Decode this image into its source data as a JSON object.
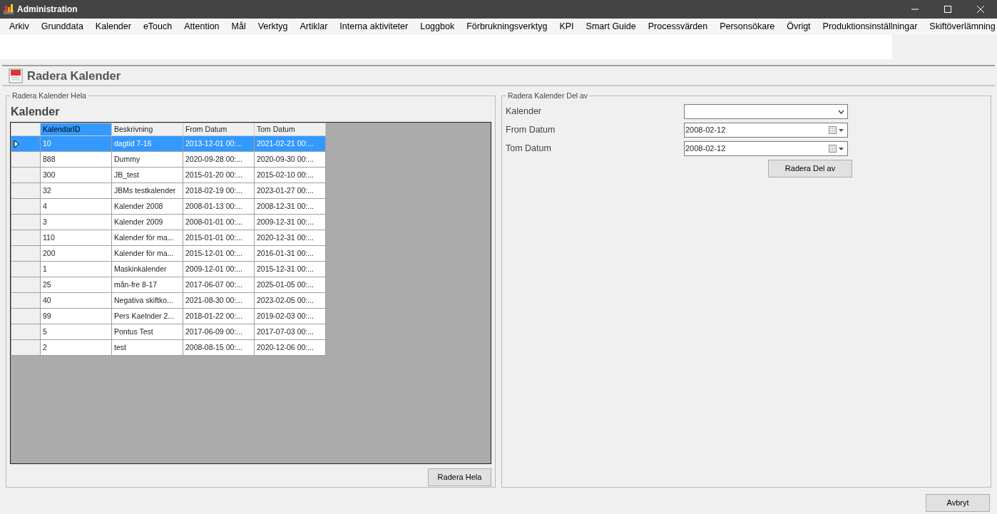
{
  "window": {
    "title": "Administration"
  },
  "menu": [
    "Arkiv",
    "Grunddata",
    "Kalender",
    "eTouch",
    "Attention",
    "Mål",
    "Verktyg",
    "Artiklar",
    "Interna aktiviteter",
    "Loggbok",
    "Förbrukningsverktyg",
    "KPI",
    "Smart Guide",
    "Processvärden",
    "Personsökare",
    "Övrigt",
    "Produktionsinställningar",
    "Skiftöverlämning"
  ],
  "page_title": "Radera Kalender",
  "left_group": {
    "legend": "Radera Kalender Hela",
    "heading": "Kalender",
    "table": {
      "columns": [
        {
          "label": "KalendarID",
          "selected": true
        },
        {
          "label": "Beskrivning",
          "selected": false
        },
        {
          "label": "From Datum",
          "selected": false
        },
        {
          "label": "Tom Datum",
          "selected": false
        }
      ],
      "rows": [
        {
          "selected": true,
          "cells": [
            "10",
            "dagtid 7-16",
            "2013-12-01 00:...",
            "2021-02-21 00:..."
          ]
        },
        {
          "selected": false,
          "cells": [
            "888",
            "Dummy",
            "2020-09-28 00:...",
            "2020-09-30 00:..."
          ]
        },
        {
          "selected": false,
          "cells": [
            "300",
            "JB_test",
            "2015-01-20 00:...",
            "2015-02-10 00:..."
          ]
        },
        {
          "selected": false,
          "cells": [
            "32",
            "JBMs testkalender",
            "2018-02-19 00:...",
            "2023-01-27 00:..."
          ]
        },
        {
          "selected": false,
          "cells": [
            "4",
            "Kalender 2008",
            "2008-01-13 00:...",
            "2008-12-31 00:..."
          ]
        },
        {
          "selected": false,
          "cells": [
            "3",
            "Kalender 2009",
            "2008-01-01 00:...",
            "2009-12-31 00:..."
          ]
        },
        {
          "selected": false,
          "cells": [
            "110",
            "Kalender för ma...",
            "2015-01-01 00:...",
            "2020-12-31 00:..."
          ]
        },
        {
          "selected": false,
          "cells": [
            "200",
            "Kalender för ma...",
            "2015-12-01 00:...",
            "2016-01-31 00:..."
          ]
        },
        {
          "selected": false,
          "cells": [
            "1",
            "Maskinkalender",
            "2009-12-01 00:...",
            "2015-12-31 00:..."
          ]
        },
        {
          "selected": false,
          "cells": [
            "25",
            "mån-fre 8-17",
            "2017-06-07 00:...",
            "2025-01-05 00:..."
          ]
        },
        {
          "selected": false,
          "cells": [
            "40",
            "Negativa skiftko...",
            "2021-08-30 00:...",
            "2023-02-05 00:..."
          ]
        },
        {
          "selected": false,
          "cells": [
            "99",
            "Pers Kaelnder 2...",
            "2018-01-22 00:...",
            "2019-02-03 00:..."
          ]
        },
        {
          "selected": false,
          "cells": [
            "5",
            "Pontus Test",
            "2017-06-09 00:...",
            "2017-07-03 00:..."
          ]
        },
        {
          "selected": false,
          "cells": [
            "2",
            "test",
            "2008-08-15 00:...",
            "2020-12-06 00:..."
          ]
        }
      ]
    },
    "button": "Radera Hela"
  },
  "right_group": {
    "legend": "Radera Kalender Del av",
    "fields": [
      {
        "kind": "dropdown",
        "label": "Kalender"
      },
      {
        "kind": "date",
        "label": "From Datum",
        "value": "2008-02-12"
      },
      {
        "kind": "date",
        "label": "Tom Datum",
        "value": "2008-02-12"
      }
    ],
    "button": "Radera Del av"
  },
  "cancel_button": "Avbryt"
}
